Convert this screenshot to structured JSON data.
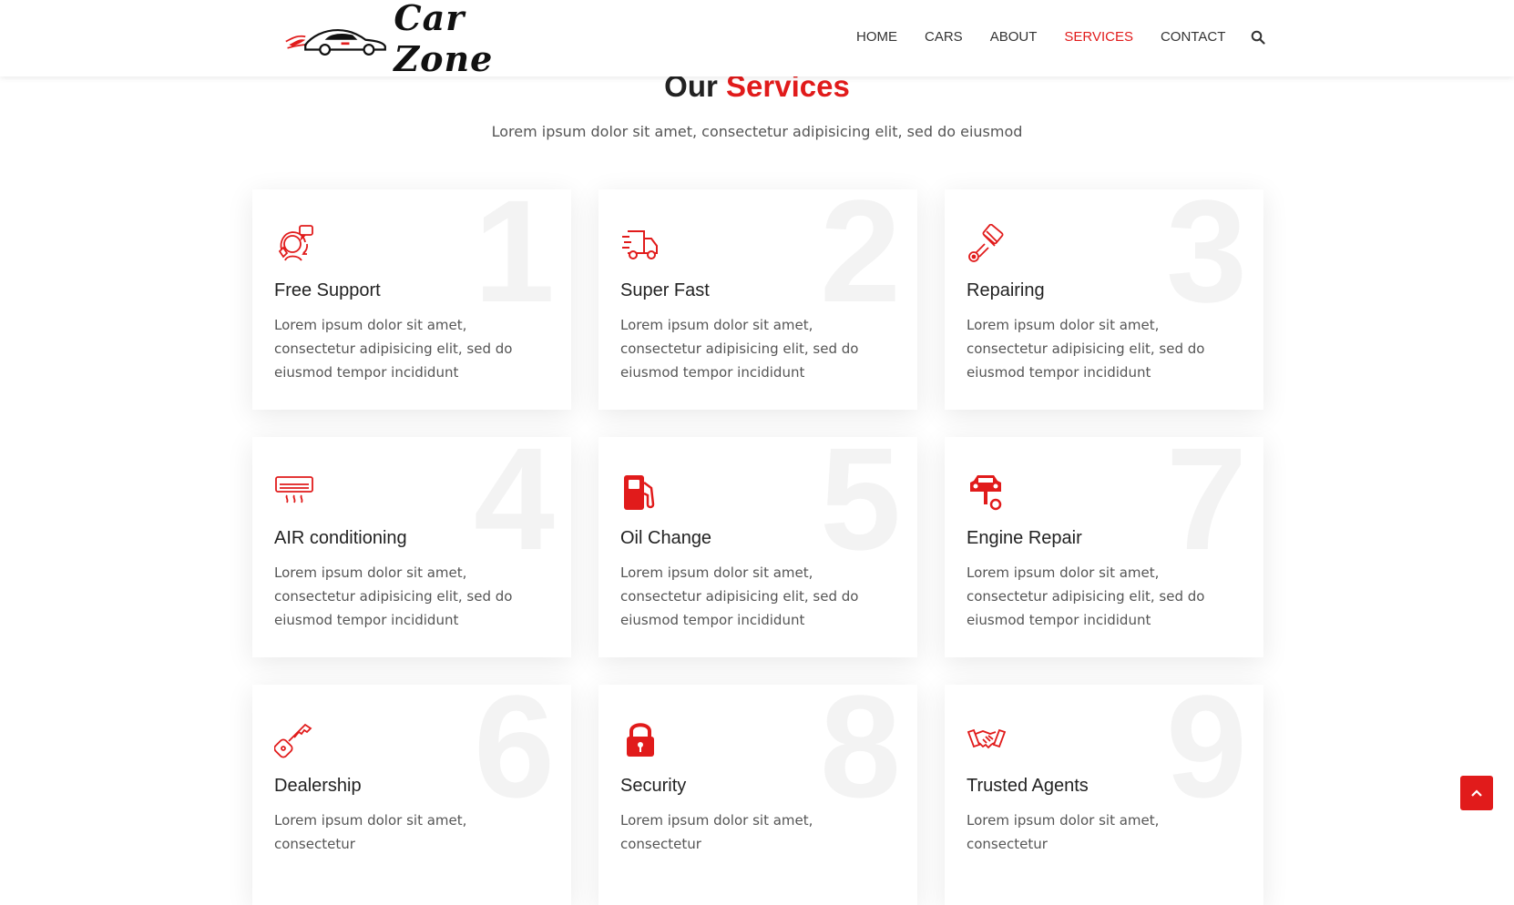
{
  "brand": {
    "name": "Car Zone",
    "accent_color": "#e11b1b"
  },
  "nav": {
    "items": [
      {
        "label": "HOME",
        "active": false
      },
      {
        "label": "CARS",
        "active": false
      },
      {
        "label": "ABOUT",
        "active": false
      },
      {
        "label": "SERVICES",
        "active": true
      },
      {
        "label": "CONTACT",
        "active": false
      }
    ],
    "search_icon": "search-icon"
  },
  "section": {
    "title_prefix": "Our",
    "title_accent": "Services",
    "subtitle": "Lorem ipsum dolor sit amet, consectetur adipisicing elit, sed do eiusmod"
  },
  "services": [
    {
      "number": "1",
      "title": "Free Support",
      "icon": "support-agent-icon",
      "text": "Lorem ipsum dolor sit amet, consectetur adipisicing elit, sed do eiusmod tempor incididunt"
    },
    {
      "number": "2",
      "title": "Super Fast",
      "icon": "fast-truck-icon",
      "text": "Lorem ipsum dolor sit amet, consectetur adipisicing elit, sed do eiusmod tempor incididunt"
    },
    {
      "number": "3",
      "title": "Repairing",
      "icon": "piston-icon",
      "text": "Lorem ipsum dolor sit amet, consectetur adipisicing elit, sed do eiusmod tempor incididunt"
    },
    {
      "number": "4",
      "title": "AIR conditioning",
      "icon": "air-conditioner-icon",
      "text": "Lorem ipsum dolor sit amet, consectetur adipisicing elit, sed do eiusmod tempor incididunt"
    },
    {
      "number": "5",
      "title": "Oil Change",
      "icon": "fuel-pump-icon",
      "text": "Lorem ipsum dolor sit amet, consectetur adipisicing elit, sed do eiusmod tempor incididunt"
    },
    {
      "number": "7",
      "title": "Engine Repair",
      "icon": "car-repair-icon",
      "text": "Lorem ipsum dolor sit amet, consectetur adipisicing elit, sed do eiusmod tempor incididunt"
    },
    {
      "number": "6",
      "title": "Dealership",
      "icon": "car-key-icon",
      "text": "Lorem ipsum dolor sit amet, consectetur"
    },
    {
      "number": "8",
      "title": "Security",
      "icon": "padlock-icon",
      "text": "Lorem ipsum dolor sit amet, consectetur"
    },
    {
      "number": "9",
      "title": "Trusted Agents",
      "icon": "handshake-icon",
      "text": "Lorem ipsum dolor sit amet, consectetur"
    }
  ],
  "scroll_top_icon": "chevron-up-icon"
}
